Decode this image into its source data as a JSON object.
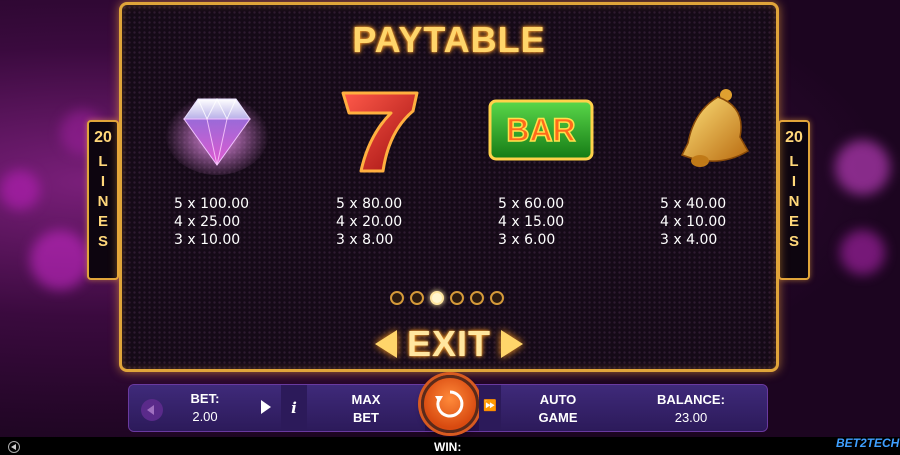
{
  "title": "PAYTABLE",
  "lines": {
    "count": "20",
    "letters": [
      "L",
      "I",
      "N",
      "E",
      "S"
    ]
  },
  "symbols": [
    {
      "icon": "diamond-icon",
      "pays": [
        "5 x 100.00",
        "4 x 25.00",
        "3 x 10.00"
      ]
    },
    {
      "icon": "seven-icon",
      "pays": [
        "5 x 80.00",
        "4 x 20.00",
        "3 x 8.00"
      ]
    },
    {
      "icon": "bar-icon",
      "label": "BAR",
      "pays": [
        "5 x 60.00",
        "4 x 15.00",
        "3 x 6.00"
      ]
    },
    {
      "icon": "bell-icon",
      "pays": [
        "5 x 40.00",
        "4 x 10.00",
        "3 x 4.00"
      ]
    }
  ],
  "pagination": {
    "total": 6,
    "current": 2
  },
  "exit_label": "EXIT",
  "controls": {
    "bet_label": "BET:",
    "bet_value": "2.00",
    "info_label": "i",
    "max_bet_line1": "MAX",
    "max_bet_line2": "BET",
    "fast_label": "⏩",
    "auto_line1": "AUTO",
    "auto_line2": "GAME",
    "balance_label": "BALANCE:",
    "balance_value": "23.00"
  },
  "footer": {
    "win_label": "WIN:",
    "brand": "BET2TECH"
  },
  "colors": {
    "gold": "#e0a53a",
    "panel_bg": "#150a17",
    "control_bg": "#2c1a5a",
    "spin": "#d84a10"
  }
}
